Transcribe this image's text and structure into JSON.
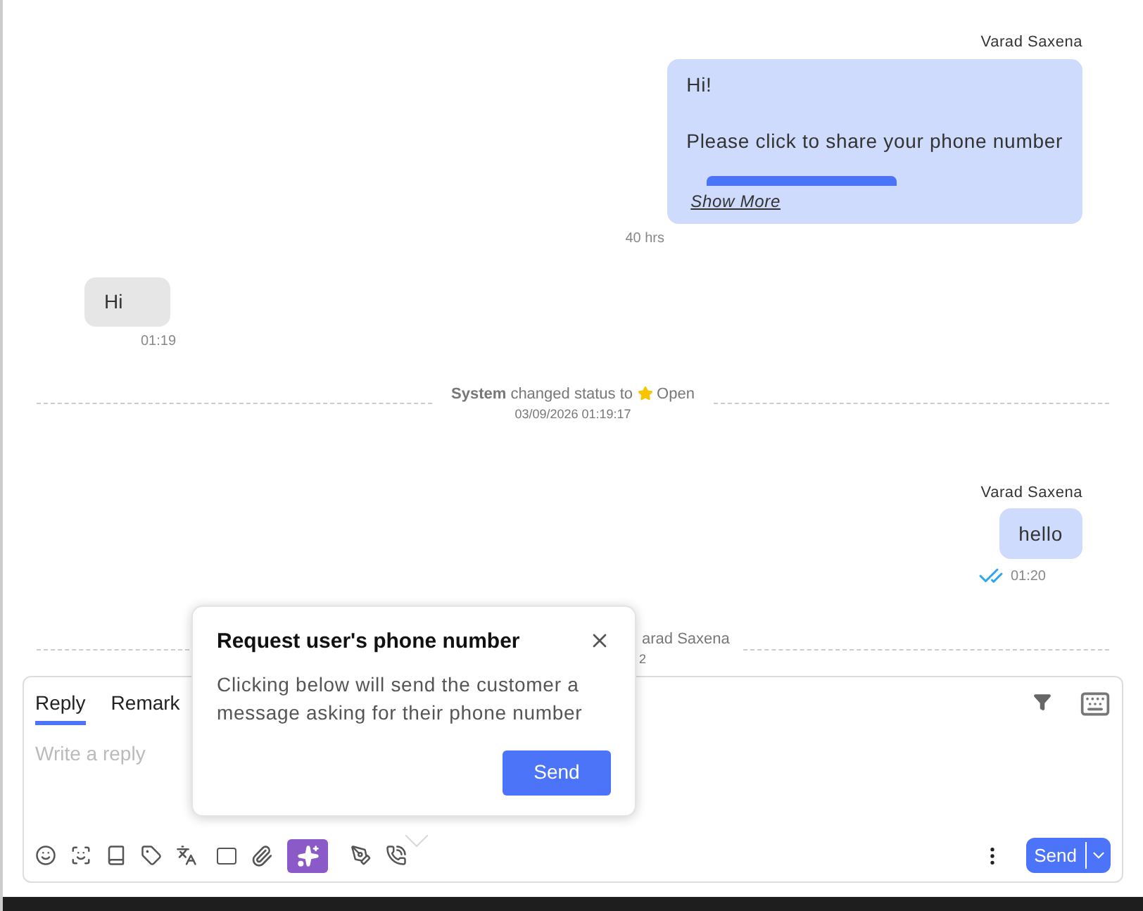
{
  "messages": [
    {
      "kind": "outgoing",
      "sender": "Varad Saxena",
      "lines": [
        "Hi!",
        "Please click to share your phone number"
      ],
      "has_button": true,
      "show_more": "Show More",
      "time": "40 hrs",
      "read": false
    },
    {
      "kind": "incoming",
      "lines": [
        "Hi"
      ],
      "time": "01:19"
    },
    {
      "kind": "system",
      "actor": "System",
      "text": "changed status to",
      "status": "Open",
      "time": "03/09/2026 01:19:17"
    },
    {
      "kind": "outgoing",
      "sender": "Varad Saxena",
      "lines": [
        "hello"
      ],
      "has_button": false,
      "time": "01:20",
      "read": true
    },
    {
      "kind": "system_partial",
      "text": "arad Saxena",
      "time": "2"
    }
  ],
  "composer": {
    "tabs": [
      {
        "label": "Reply",
        "selected": true
      },
      {
        "label": "Remark",
        "selected": false
      }
    ],
    "placeholder": "Write a reply",
    "send": "Send"
  },
  "popover": {
    "title": "Request user's phone number",
    "body": "Clicking below will send the customer a message asking for their phone number",
    "button": "Send"
  }
}
